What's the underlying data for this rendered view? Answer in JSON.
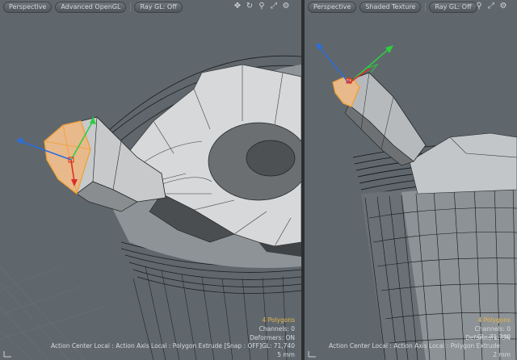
{
  "viewports": [
    {
      "id": "left",
      "toolbar": {
        "view_mode": "Perspective",
        "render_mode": "Advanced OpenGL",
        "raygl": "Ray GL: Off"
      },
      "stats": {
        "polygons": "4 Polygons",
        "channels": "Channels: 0",
        "deformers": "Deformers: ON",
        "gl": "GL: 71,740",
        "scale": "5 mm"
      },
      "status_text": "Action Center Local : Action Axis Local : Polygon Extrude  [Snap : OFF]"
    },
    {
      "id": "right",
      "toolbar": {
        "view_mode": "Perspective",
        "render_mode": "Shaded Texture",
        "raygl": "Ray GL: Off"
      },
      "stats": {
        "polygons": "4 Polygons",
        "channels": "Channels: 0",
        "deformers": "Deformers: ON",
        "gl": "GL: 71,740",
        "scale": "2 mm"
      },
      "status_text": "Action Center Local : Action Axis Local : Polygon Extrude"
    }
  ],
  "toolbar_icons": [
    "move-view-icon",
    "rotate-view-icon",
    "zoom-view-icon",
    "maximize-viewport-icon",
    "viewport-options-icon"
  ],
  "colors": {
    "viewport_bg": "#5f676d",
    "toolbar_button": "#5a6267",
    "selection_face": "#e8b98a",
    "selection_edge": "#f0a030",
    "axis_x": "#e02a2a",
    "axis_y": "#2ecc40",
    "axis_z": "#2a6ee0",
    "highlight_text": "#e6b84a"
  }
}
